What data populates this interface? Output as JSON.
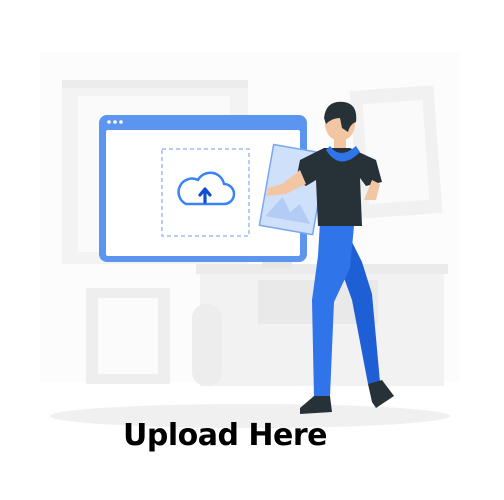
{
  "caption": "Upload Here",
  "colors": {
    "accent_blue": "#3b82f6",
    "person_pants": "#2f74e8",
    "person_shirt": "#263238",
    "skin": "#f3c6a3",
    "hair": "#263238",
    "background_shapes": "#f4f4f4"
  },
  "icons": {
    "upload": "cloud-upload-icon"
  }
}
